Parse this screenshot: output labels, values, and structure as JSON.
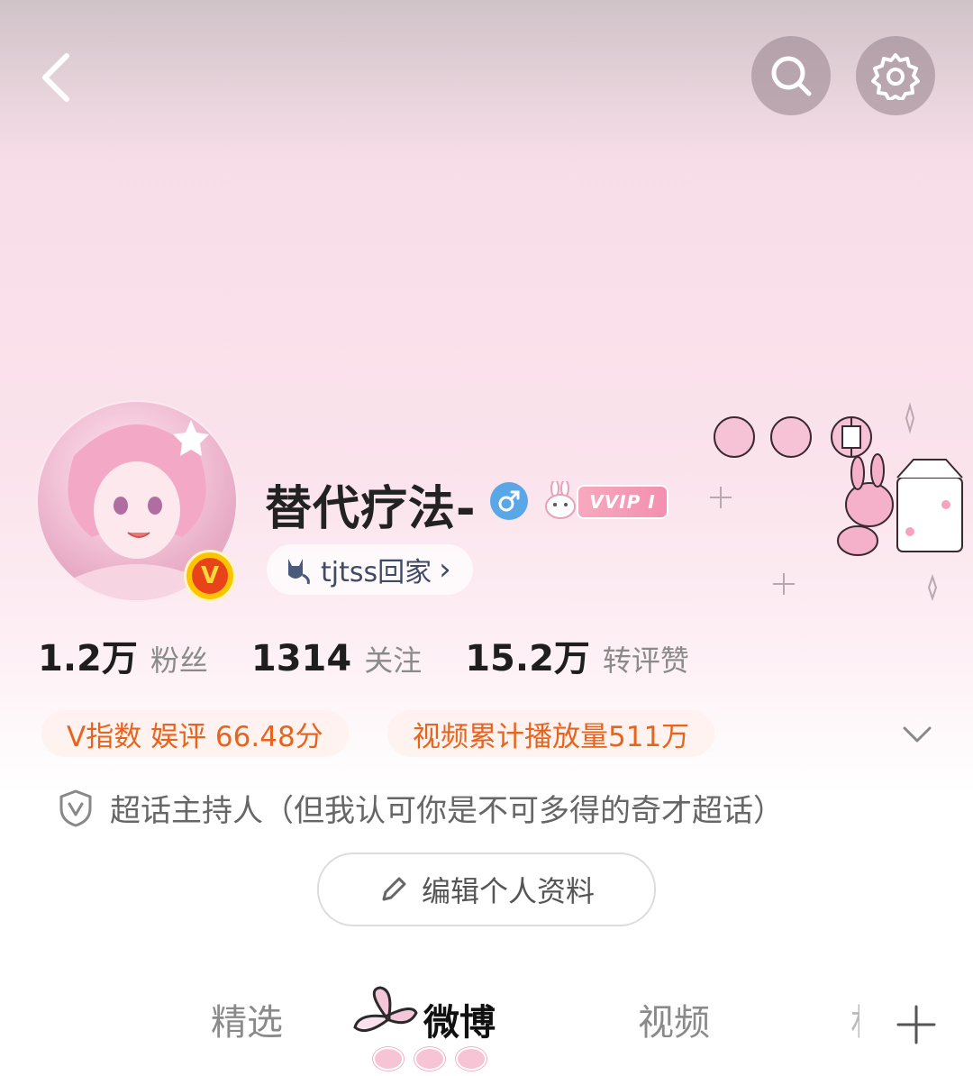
{
  "header": {
    "back_icon": "chevron-left-icon",
    "search_icon": "search-icon",
    "settings_icon": "gear-icon"
  },
  "profile": {
    "username": "替代疗法-",
    "gender_icon": "male-icon",
    "vip_badge": "VVIP I",
    "verified_badge": "V",
    "home_link": "tjtss回家",
    "home_link_chevron": "›"
  },
  "stats": [
    {
      "value": "1.2万",
      "label": "粉丝"
    },
    {
      "value": "1314",
      "label": "关注"
    },
    {
      "value": "15.2万",
      "label": "转评赞"
    }
  ],
  "tags": {
    "v_index": "V指数 娱评 66.48分",
    "video_plays": "视频累计播放量511万"
  },
  "role": {
    "icon": "shield-v-icon",
    "text": "超话主持人（但我认可你是不可多得的奇才超话）"
  },
  "edit_button": {
    "icon": "pencil-icon",
    "label": "编辑个人资料"
  },
  "tabs": [
    {
      "label": "精选"
    },
    {
      "label": "微博",
      "active": true
    },
    {
      "label": "视频"
    },
    {
      "label": "相"
    }
  ],
  "add_tab_icon": "plus-icon",
  "colors": {
    "accent_orange": "#e8641e",
    "gender_blue": "#5aa7e8",
    "badge_red": "#e8431b",
    "badge_gold": "#ffc400"
  }
}
